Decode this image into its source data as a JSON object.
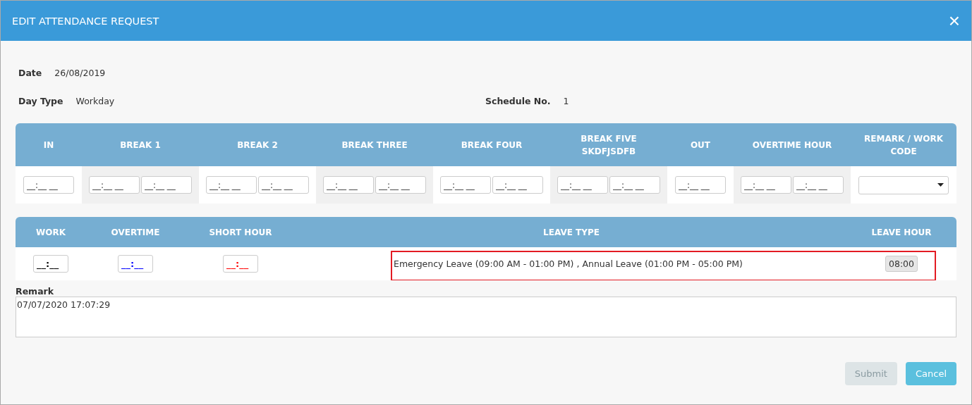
{
  "dialog": {
    "title": "EDIT ATTENDANCE REQUEST",
    "close": "×"
  },
  "info": {
    "date_label": "Date",
    "date": "26/08/2019",
    "day_type_label": "Day Type",
    "day_type": "Workday",
    "schedule_label": "Schedule No.",
    "schedule": "1"
  },
  "time_table": {
    "columns": [
      {
        "header": "IN",
        "kind": "single",
        "placeholder": "__:__ __"
      },
      {
        "header": "BREAK 1",
        "kind": "pair",
        "placeholder": "__:__ __"
      },
      {
        "header": "BREAK 2",
        "kind": "pair",
        "placeholder": "__:__ __"
      },
      {
        "header": "BREAK THREE",
        "kind": "pair",
        "placeholder": "__:__ __"
      },
      {
        "header": "BREAK FOUR",
        "kind": "pair",
        "placeholder": "__:__ __"
      },
      {
        "header": "BREAK FIVE SKDFJSDFB",
        "kind": "pair",
        "placeholder": "__:__ __"
      },
      {
        "header": "OUT",
        "kind": "single",
        "placeholder": "__:__ __"
      },
      {
        "header": "OVERTIME HOUR",
        "kind": "pair",
        "placeholder": "__:__ __"
      },
      {
        "header": "REMARK / WORK CODE",
        "kind": "dropdown"
      }
    ]
  },
  "summary_table": {
    "columns": [
      {
        "header": "WORK",
        "kind": "time",
        "placeholder": "__:__",
        "color": "#000000"
      },
      {
        "header": "OVERTIME",
        "kind": "time",
        "placeholder": "__:__",
        "color": "#0000ff"
      },
      {
        "header": "SHORT HOUR",
        "kind": "time",
        "placeholder": "__:__",
        "color": "#ff0000"
      },
      {
        "header": "LEAVE TYPE",
        "kind": "text",
        "value": "Emergency Leave (09:00 AM - 01:00 PM) , Annual Leave (01:00 PM - 05:00 PM)"
      },
      {
        "header": "LEAVE HOUR",
        "kind": "readonly",
        "value": "08:00"
      }
    ],
    "highlighted": true
  },
  "remark": {
    "label": "Remark",
    "value": "07/07/2020 17:07:29"
  },
  "buttons": [
    {
      "label": "Submit",
      "kind": "primary",
      "disabled": true
    },
    {
      "label": "Cancel",
      "kind": "secondary",
      "disabled": false
    }
  ]
}
